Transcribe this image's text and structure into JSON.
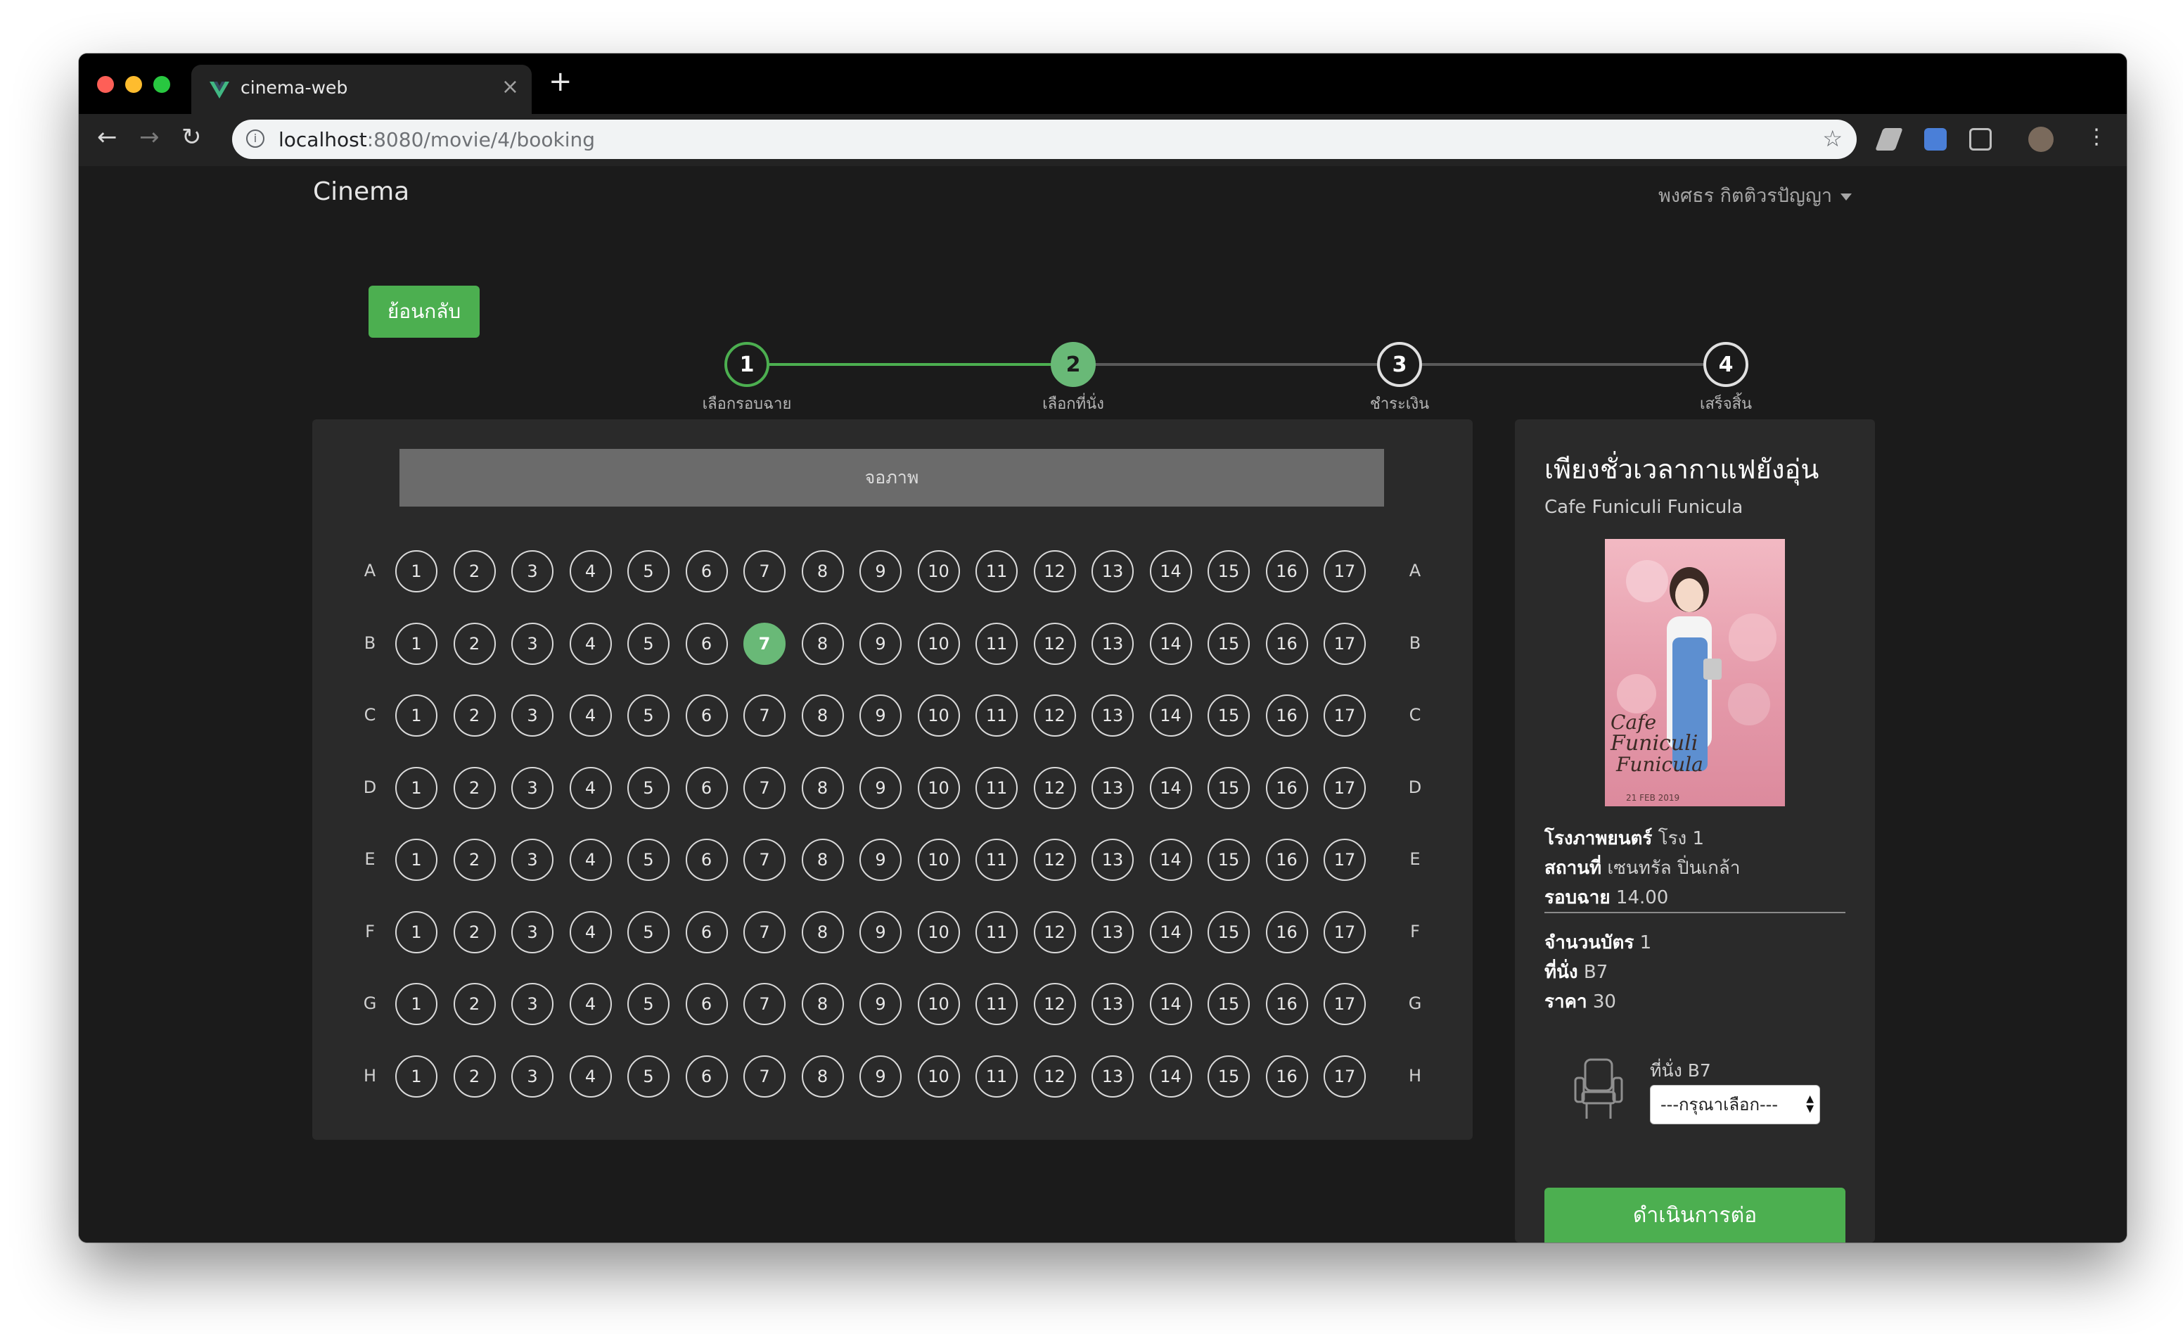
{
  "browser": {
    "tab_title": "cinema-web",
    "url_host": "localhost",
    "url_path": ":8080/movie/4/booking"
  },
  "app": {
    "brand": "Cinema",
    "user_name": "พงศธร กิตติวรปัญญา"
  },
  "back_label": "ย้อนกลับ",
  "steps": [
    {
      "number": "1",
      "label": "เลือกรอบฉาย",
      "state": "done"
    },
    {
      "number": "2",
      "label": "เลือกที่นั่ง",
      "state": "active"
    },
    {
      "number": "3",
      "label": "ชำระเงิน",
      "state": "pending"
    },
    {
      "number": "4",
      "label": "เสร็จสิ้น",
      "state": "pending"
    }
  ],
  "seating": {
    "screen_label": "จอภาพ",
    "rows": [
      "A",
      "B",
      "C",
      "D",
      "E",
      "F",
      "G",
      "H"
    ],
    "seats": [
      "1",
      "2",
      "3",
      "4",
      "5",
      "6",
      "7",
      "8",
      "9",
      "10",
      "11",
      "12",
      "13",
      "14",
      "15",
      "16",
      "17"
    ],
    "selected": "B7"
  },
  "movie": {
    "title_th": "เพียงชั่วเวลากาแฟยังอุ่น",
    "title_en": "Cafe Funiculi Funicula",
    "poster_text": "Cafe Funiculi Funicula",
    "poster_date": "21 FEB 2019"
  },
  "booking": {
    "theater_label": "โรงภาพยนตร์",
    "theater_value": "โรง 1",
    "location_label": "สถานที่",
    "location_value": "เซนทรัล ปิ่นเกล้า",
    "showtime_label": "รอบฉาย",
    "showtime_value": "14.00",
    "tickets_label": "จำนวนบัตร",
    "tickets_value": "1",
    "seat_label": "ที่นั่ง",
    "seat_value": "B7",
    "price_label": "ราคา",
    "price_value": "30",
    "seat_pick_label": "ที่นั่ง B7",
    "ticket_type_placeholder": "---กรุณาเลือก---",
    "continue_label": "ดำเนินการต่อ"
  },
  "colors": {
    "accent": "#4caf50",
    "selected_seat": "#69b977",
    "background": "#1b1b1b",
    "panel": "#2a2a2a"
  }
}
